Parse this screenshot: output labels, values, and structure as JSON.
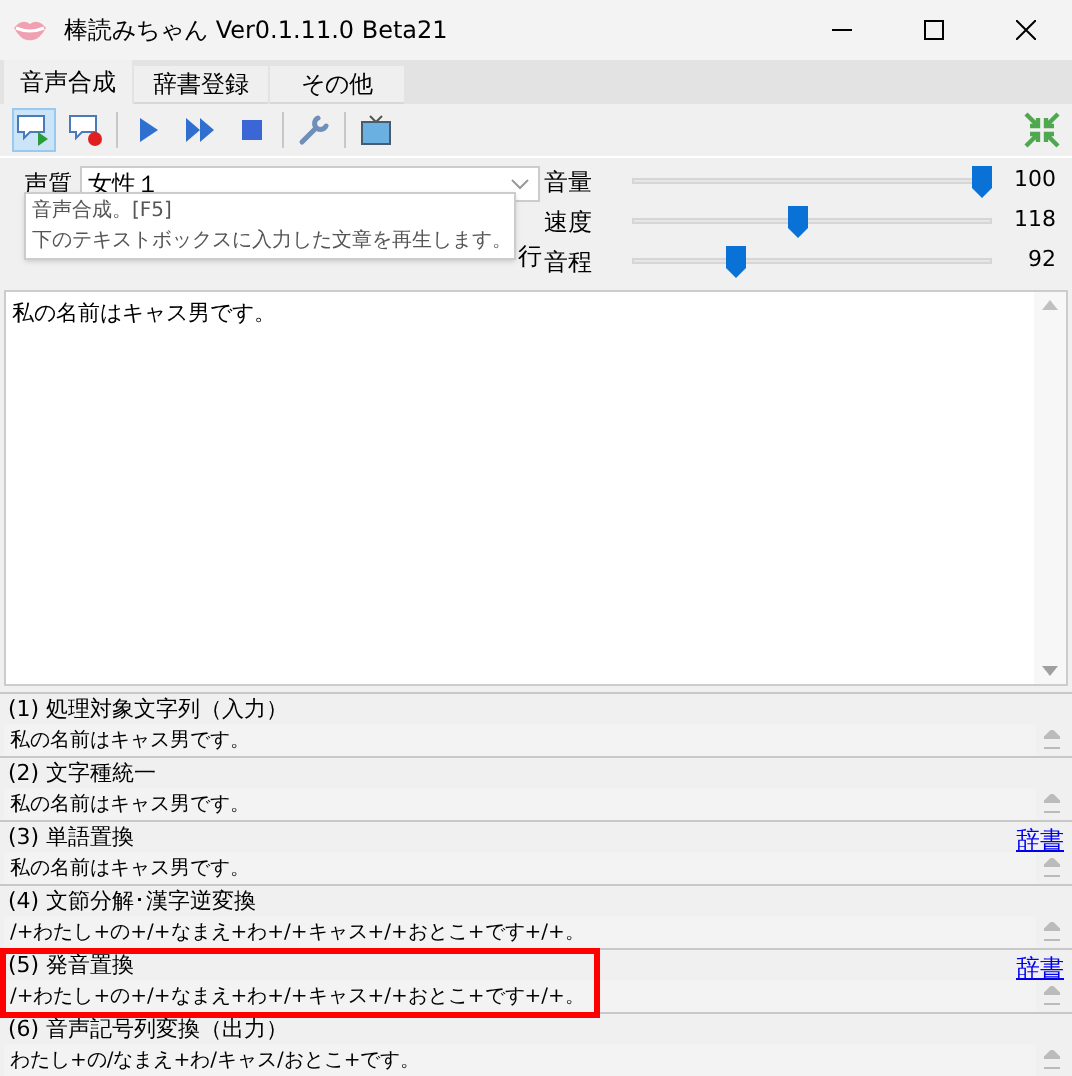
{
  "window": {
    "title": "棒読みちゃん Ver0.1.11.0 Beta21"
  },
  "tabs": [
    {
      "label": "音声合成",
      "selected": true
    },
    {
      "label": "辞書登録",
      "selected": false
    },
    {
      "label": "その他",
      "selected": false
    }
  ],
  "toolbar": [
    {
      "kind": "speak",
      "selected": true
    },
    {
      "kind": "stop-speak",
      "selected": false
    },
    {
      "kind": "play",
      "selected": false
    },
    {
      "kind": "skip",
      "selected": false
    },
    {
      "kind": "stop",
      "selected": false
    },
    {
      "kind": "settings",
      "selected": false
    },
    {
      "kind": "tv",
      "selected": false
    }
  ],
  "voice": {
    "label": "声質",
    "value": "女性１"
  },
  "hidden_row_fragment": "行",
  "tooltip": {
    "title": "音声合成。[F5]",
    "text": "下のテキストボックスに入力した文章を再生します。"
  },
  "sliders": [
    {
      "label": "音量",
      "level": 0.97,
      "reading": "100"
    },
    {
      "label": "速度",
      "level": 0.46,
      "reading": "118"
    },
    {
      "label": "音程",
      "level": 0.29,
      "reading": "92"
    }
  ],
  "input_text": "私の名前はキャス男です。",
  "stages": [
    {
      "heading": "(1) 処理対象文字列（入力）",
      "value": "私の名前はキャス男です。",
      "highlighted": false
    },
    {
      "heading": "(2) 文字種統一",
      "value": "私の名前はキャス男です。",
      "highlighted": false
    },
    {
      "heading": "(3) 単語置換",
      "value": "私の名前はキャス男です。",
      "link": "辞書",
      "highlighted": false
    },
    {
      "heading": "(4) 文節分解･漢字逆変換",
      "value": "/+わたし+の+/+なまえ+わ+/+キャス+/+おとこ+です+/+。",
      "highlighted": false
    },
    {
      "heading": "(5) 発音置換",
      "value": "/+わたし+の+/+なまえ+わ+/+キャス+/+おとこ+です+/+。",
      "link": "辞書",
      "highlighted": true
    },
    {
      "heading": "(6) 音声記号列変換（出力）",
      "value": "わたし+の/なまえ+わ/キャス/おとこ+です。",
      "highlighted": false
    }
  ]
}
